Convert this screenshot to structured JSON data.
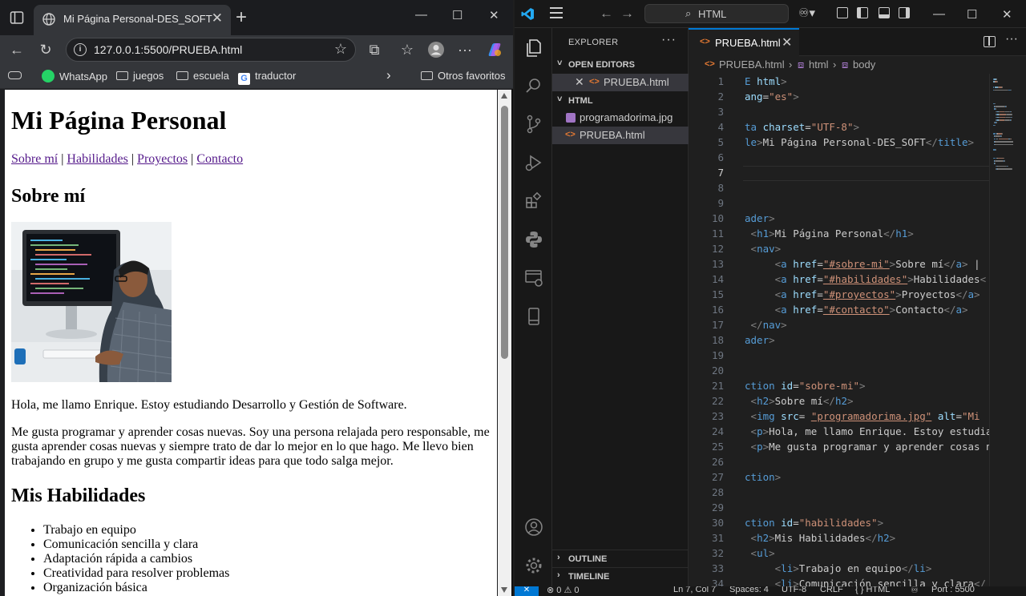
{
  "browser": {
    "tab_title": "Mi Página Personal-DES_SOFT",
    "url": "127.0.0.1:5500/PRUEBA.html",
    "bookmarks": [
      "WhatsApp",
      "juegos",
      "escuela",
      "traductor"
    ],
    "other_favorites": "Otros favoritos",
    "icons": [
      "sidebar-icon",
      "globe-icon",
      "close-icon",
      "plus-icon",
      "minimize-icon",
      "maximize-icon",
      "back-icon",
      "reload-icon",
      "info-icon",
      "star-icon",
      "extensions-icon",
      "favorites-icon",
      "profile-icon",
      "more-icon",
      "copilot-icon"
    ]
  },
  "page": {
    "title": "Mi Página Personal",
    "nav": [
      "Sobre mí",
      "Habilidades",
      "Proyectos",
      "Contacto"
    ],
    "nav_sep": "|",
    "about_heading": "Sobre mí",
    "intro": "Hola, me llamo Enrique. Estoy estudiando Desarrollo y Gestión de Software.",
    "para": "Me gusta programar y aprender cosas nuevas. Soy una persona relajada pero responsable, me gusta aprender cosas nuevas y siempre trato de dar lo mejor en lo que hago. Me llevo bien trabajando en grupo y me gusta compartir ideas para que todo salga mejor.",
    "skills_heading": "Mis Habilidades",
    "skills": [
      "Trabajo en equipo",
      "Comunicación sencilla y clara",
      "Adaptación rápida a cambios",
      "Creatividad para resolver problemas",
      "Organización básica"
    ]
  },
  "vscode": {
    "search": "HTML",
    "explorer_title": "EXPLORER",
    "open_editors": "OPEN EDITORS",
    "folder": "HTML",
    "open_file": "PRUEBA.html",
    "files": [
      "programadorima.jpg",
      "PRUEBA.html"
    ],
    "outline": "OUTLINE",
    "timeline": "TIMELINE",
    "tab": "PRUEBA.html",
    "breadcrumb": [
      "PRUEBA.html",
      "html",
      "body"
    ],
    "current_line": 7,
    "status": {
      "problems": "⊗ 0 ⚠ 0",
      "position": "Ln 7, Col 7",
      "spaces": "Spaces: 4",
      "encoding": "UTF-8",
      "eol": "CRLF",
      "lang": "{ } HTML",
      "port": "Port : 5500"
    },
    "code_lines": [
      [
        [
          "t-tag",
          "E "
        ],
        [
          "t-attr",
          "html"
        ],
        [
          "t-br",
          ">"
        ]
      ],
      [
        [
          "t-attr",
          "ang"
        ],
        [
          "t-tx",
          "="
        ],
        [
          "t-str",
          "\"es\""
        ],
        [
          "t-br",
          ">"
        ]
      ],
      [],
      [
        [
          "t-tag",
          "ta "
        ],
        [
          "t-attr",
          "charset"
        ],
        [
          "t-tx",
          "="
        ],
        [
          "t-str",
          "\"UTF-8\""
        ],
        [
          "t-br",
          ">"
        ]
      ],
      [
        [
          "t-tag",
          "le"
        ],
        [
          "t-br",
          ">"
        ],
        [
          "t-tx",
          "Mi Página Personal-DES_SOFT"
        ],
        [
          "t-br",
          "</"
        ],
        [
          "t-tag",
          "title"
        ],
        [
          "t-br",
          ">"
        ]
      ],
      [],
      [],
      [],
      [],
      [
        [
          "t-tag",
          "ader"
        ],
        [
          "t-br",
          ">"
        ]
      ],
      [
        [
          "t-tx",
          " "
        ],
        [
          "t-br",
          "<"
        ],
        [
          "t-tag",
          "h1"
        ],
        [
          "t-br",
          ">"
        ],
        [
          "t-tx",
          "Mi Página Personal"
        ],
        [
          "t-br",
          "</"
        ],
        [
          "t-tag",
          "h1"
        ],
        [
          "t-br",
          ">"
        ]
      ],
      [
        [
          "t-tx",
          " "
        ],
        [
          "t-br",
          "<"
        ],
        [
          "t-tag",
          "nav"
        ],
        [
          "t-br",
          ">"
        ]
      ],
      [
        [
          "t-tx",
          "     "
        ],
        [
          "t-br",
          "<"
        ],
        [
          "t-tag",
          "a "
        ],
        [
          "t-attr",
          "href"
        ],
        [
          "t-tx",
          "="
        ],
        [
          "t-str",
          "\"#sobre-mi\""
        ],
        [
          "t-br",
          ">"
        ],
        [
          "t-tx",
          "Sobre mí"
        ],
        [
          "t-br",
          "</"
        ],
        [
          "t-tag",
          "a"
        ],
        [
          "t-br",
          ">"
        ],
        [
          "t-tx",
          " |"
        ]
      ],
      [
        [
          "t-tx",
          "     "
        ],
        [
          "t-br",
          "<"
        ],
        [
          "t-tag",
          "a "
        ],
        [
          "t-attr",
          "href"
        ],
        [
          "t-tx",
          "="
        ],
        [
          "t-str",
          "\"#habilidades\""
        ],
        [
          "t-br",
          ">"
        ],
        [
          "t-tx",
          "Habilidades"
        ],
        [
          "t-br",
          "<"
        ]
      ],
      [
        [
          "t-tx",
          "     "
        ],
        [
          "t-br",
          "<"
        ],
        [
          "t-tag",
          "a "
        ],
        [
          "t-attr",
          "href"
        ],
        [
          "t-tx",
          "="
        ],
        [
          "t-str",
          "\"#proyectos\""
        ],
        [
          "t-br",
          ">"
        ],
        [
          "t-tx",
          "Proyectos"
        ],
        [
          "t-br",
          "</"
        ],
        [
          "t-tag",
          "a"
        ],
        [
          "t-br",
          ">"
        ]
      ],
      [
        [
          "t-tx",
          "     "
        ],
        [
          "t-br",
          "<"
        ],
        [
          "t-tag",
          "a "
        ],
        [
          "t-attr",
          "href"
        ],
        [
          "t-tx",
          "="
        ],
        [
          "t-str",
          "\"#contacto\""
        ],
        [
          "t-br",
          ">"
        ],
        [
          "t-tx",
          "Contacto"
        ],
        [
          "t-br",
          "</"
        ],
        [
          "t-tag",
          "a"
        ],
        [
          "t-br",
          ">"
        ]
      ],
      [
        [
          "t-tx",
          " "
        ],
        [
          "t-br",
          "</"
        ],
        [
          "t-tag",
          "nav"
        ],
        [
          "t-br",
          ">"
        ]
      ],
      [
        [
          "t-tag",
          "ader"
        ],
        [
          "t-br",
          ">"
        ]
      ],
      [],
      [],
      [
        [
          "t-tag",
          "ction "
        ],
        [
          "t-attr",
          "id"
        ],
        [
          "t-tx",
          "="
        ],
        [
          "t-str",
          "\"sobre-mi\""
        ],
        [
          "t-br",
          ">"
        ]
      ],
      [
        [
          "t-tx",
          " "
        ],
        [
          "t-br",
          "<"
        ],
        [
          "t-tag",
          "h2"
        ],
        [
          "t-br",
          ">"
        ],
        [
          "t-tx",
          "Sobre mí"
        ],
        [
          "t-br",
          "</"
        ],
        [
          "t-tag",
          "h2"
        ],
        [
          "t-br",
          ">"
        ]
      ],
      [
        [
          "t-tx",
          " "
        ],
        [
          "t-br",
          "<"
        ],
        [
          "t-tag",
          "img "
        ],
        [
          "t-attr",
          "src"
        ],
        [
          "t-tx",
          "= "
        ],
        [
          "t-str",
          "\"programadorima.jpg\""
        ],
        [
          "t-tx",
          " "
        ],
        [
          "t-attr",
          "alt"
        ],
        [
          "t-tx",
          "="
        ],
        [
          "t-str",
          "\"Mi "
        ]
      ],
      [
        [
          "t-tx",
          " "
        ],
        [
          "t-br",
          "<"
        ],
        [
          "t-tag",
          "p"
        ],
        [
          "t-br",
          ">"
        ],
        [
          "t-tx",
          "Hola, me llamo Enrique. Estoy estudia"
        ]
      ],
      [
        [
          "t-tx",
          " "
        ],
        [
          "t-br",
          "<"
        ],
        [
          "t-tag",
          "p"
        ],
        [
          "t-br",
          ">"
        ],
        [
          "t-tx",
          "Me gusta programar y aprender cosas n"
        ]
      ],
      [],
      [
        [
          "t-tag",
          "ction"
        ],
        [
          "t-br",
          ">"
        ]
      ],
      [],
      [],
      [
        [
          "t-tag",
          "ction "
        ],
        [
          "t-attr",
          "id"
        ],
        [
          "t-tx",
          "="
        ],
        [
          "t-str",
          "\"habilidades\""
        ],
        [
          "t-br",
          ">"
        ]
      ],
      [
        [
          "t-tx",
          " "
        ],
        [
          "t-br",
          "<"
        ],
        [
          "t-tag",
          "h2"
        ],
        [
          "t-br",
          ">"
        ],
        [
          "t-tx",
          "Mis Habilidades"
        ],
        [
          "t-br",
          "</"
        ],
        [
          "t-tag",
          "h2"
        ],
        [
          "t-br",
          ">"
        ]
      ],
      [
        [
          "t-tx",
          " "
        ],
        [
          "t-br",
          "<"
        ],
        [
          "t-tag",
          "ul"
        ],
        [
          "t-br",
          ">"
        ]
      ],
      [
        [
          "t-tx",
          "     "
        ],
        [
          "t-br",
          "<"
        ],
        [
          "t-tag",
          "li"
        ],
        [
          "t-br",
          ">"
        ],
        [
          "t-tx",
          "Trabajo en equipo"
        ],
        [
          "t-br",
          "</"
        ],
        [
          "t-tag",
          "li"
        ],
        [
          "t-br",
          ">"
        ]
      ],
      [
        [
          "t-tx",
          "     "
        ],
        [
          "t-br",
          "<"
        ],
        [
          "t-tag",
          "li"
        ],
        [
          "t-br",
          ">"
        ],
        [
          "t-tx",
          "Comunicación sencilla y clara"
        ],
        [
          "t-br",
          "</"
        ]
      ]
    ]
  }
}
